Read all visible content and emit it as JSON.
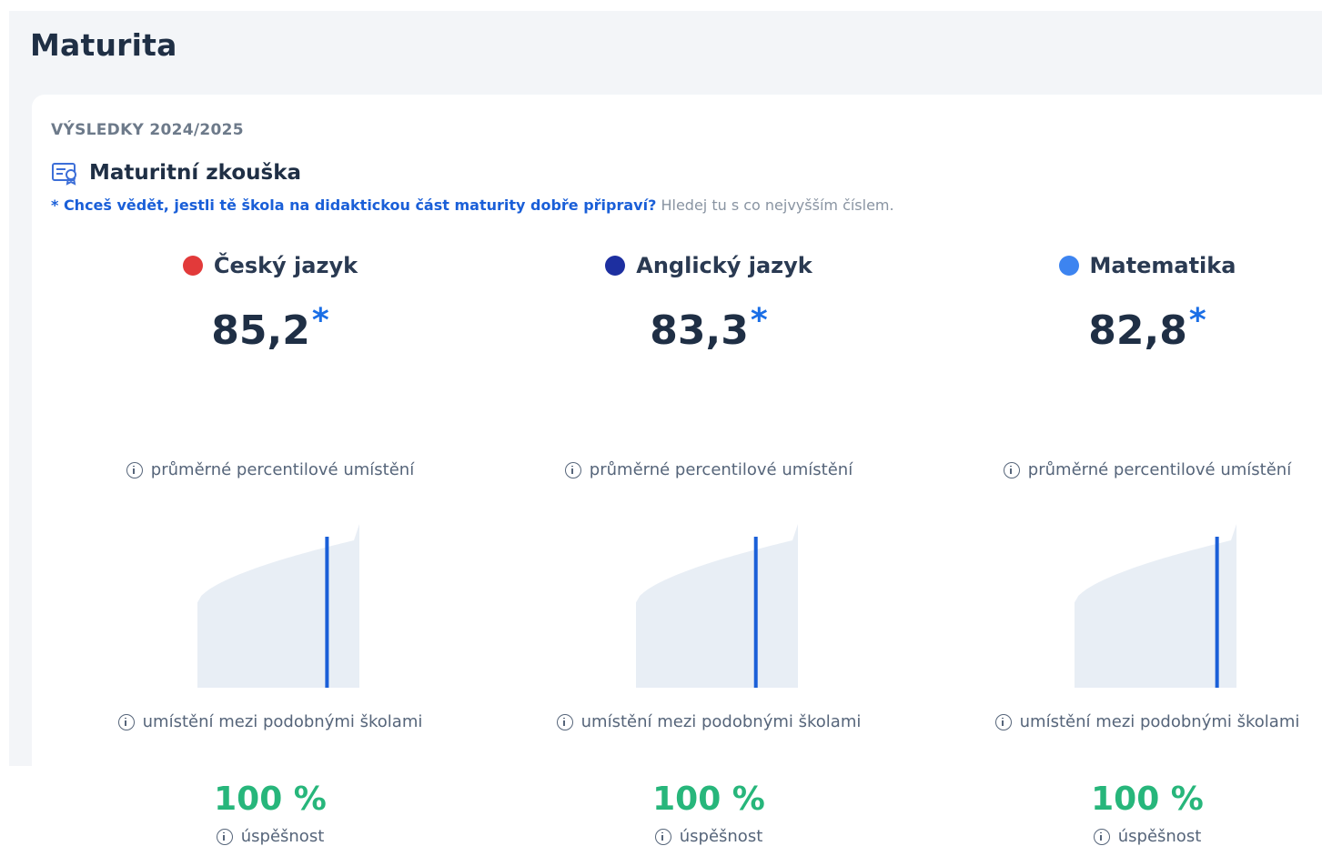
{
  "page": {
    "title": "Maturita"
  },
  "card": {
    "results_label": "VÝSLEDKY 2024/2025",
    "section_title": "Maturitní zkouška",
    "section_icon": "certificate-icon",
    "note_link": "* Chceš vědět, jestli tě škola na didaktickou část maturity dobře připraví?",
    "note_rest": " Hledej tu s co nejvyšším číslem."
  },
  "subjects": [
    {
      "name": "Český jazyk",
      "dot_color": "#e23a3a",
      "score": "85,2",
      "star": "*",
      "percentile_label": "průměrné percentilové umístění",
      "placement_label": "umístění mezi podobnými školami",
      "placement_percentile": 0.8,
      "success_value": "100 %",
      "success_label": "úspěšnost"
    },
    {
      "name": "Anglický jazyk",
      "dot_color": "#1d2fa0",
      "score": "83,3",
      "star": "*",
      "percentile_label": "průměrné percentilové umístění",
      "placement_label": "umístění mezi podobnými školami",
      "placement_percentile": 0.74,
      "success_value": "100 %",
      "success_label": "úspěšnost"
    },
    {
      "name": "Matematika",
      "dot_color": "#3d84f0",
      "score": "82,8",
      "star": "*",
      "percentile_label": "průměrné percentilové umístění",
      "placement_label": "umístění mezi podobnými školami",
      "placement_percentile": 0.88,
      "success_value": "100 %",
      "success_label": "úspěšnost"
    }
  ],
  "colors": {
    "chart_fill": "#e8eef5",
    "marker": "#1a5fd8",
    "success": "#27b67b",
    "accent_star": "#1a6ee6"
  }
}
